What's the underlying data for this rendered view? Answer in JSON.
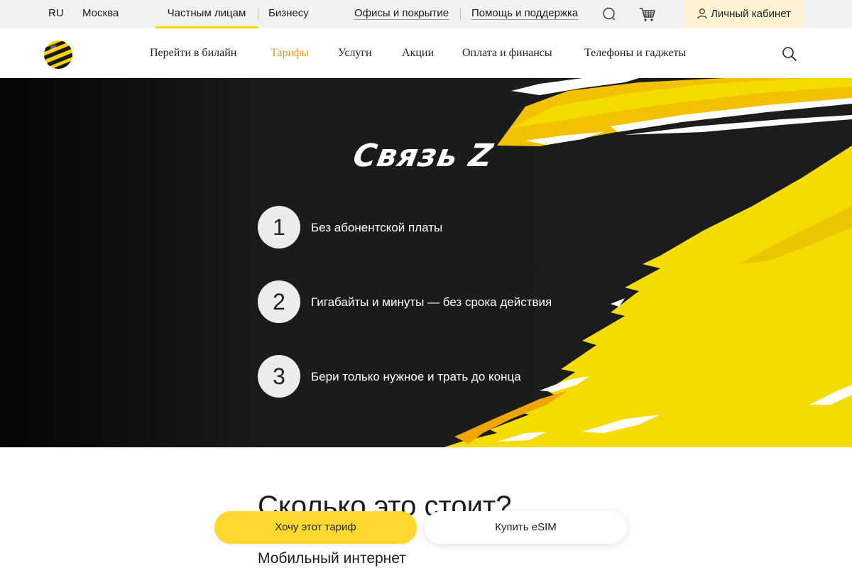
{
  "utility": {
    "lang": "RU",
    "city": "Москва",
    "tabs": [
      "Частным лицам",
      "Бизнесу"
    ],
    "links": [
      "Офисы и покрытие",
      "Помощь и поддержка"
    ],
    "icons": [
      "chat-icon",
      "cart-icon",
      "user-icon"
    ],
    "cabinet": "Личный кабинет",
    "accent": "#ffd200"
  },
  "nav": {
    "items": [
      "Перейти в билайн",
      "Тарифы",
      "Услуги",
      "Акции",
      "Оплата и финансы",
      "Телефоны и гаджеты"
    ],
    "active": "Тарифы",
    "active_color": "#f09a1d",
    "logo_icon": "beeline-logo-icon",
    "search_icon": "search-icon"
  },
  "hero": {
    "title": "Связь Z",
    "features": [
      {
        "num": "1",
        "text": "Без абонентской платы"
      },
      {
        "num": "2",
        "text": "Гигабайты и минуты — без срока действия"
      },
      {
        "num": "3",
        "text": "Бери только нужное и трать до конца"
      }
    ],
    "paint_color": "#f5dc00"
  },
  "pricing": {
    "heading": "Сколько это стоит?",
    "subheading": "Мобильный интернет"
  },
  "actions": {
    "primary": "Хочу этот тариф",
    "secondary": "Купить eSIM",
    "primary_color": "#ffd92e"
  }
}
